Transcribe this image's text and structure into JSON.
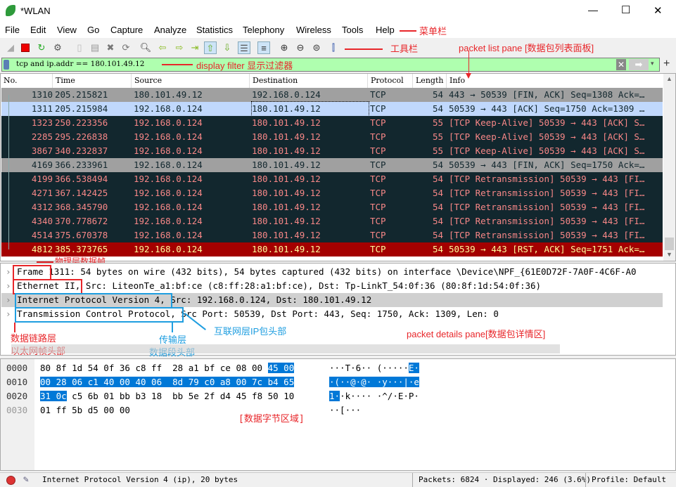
{
  "window": {
    "title": "*WLAN",
    "minimize": "—",
    "maximize": "☐",
    "close": "✕"
  },
  "menu": [
    "File",
    "Edit",
    "View",
    "Go",
    "Capture",
    "Analyze",
    "Statistics",
    "Telephony",
    "Wireless",
    "Tools",
    "Help"
  ],
  "toolbar_icons": [
    "shark-fin-start-icon",
    "stop-capture-icon",
    "restart-capture-icon",
    "capture-options-icon",
    "open-file-icon",
    "save-file-icon",
    "close-file-icon",
    "reload-file-icon",
    "find-packet-icon",
    "go-back-icon",
    "go-forward-icon",
    "go-to-packet-icon",
    "first-packet-icon",
    "last-packet-icon",
    "autoscroll-icon",
    "colorize-icon",
    "zoom-in-icon",
    "zoom-out-icon",
    "zoom-normal-icon",
    "resize-columns-icon"
  ],
  "filter": {
    "value": "tcp and ip.addr == 180.101.49.12"
  },
  "columns": [
    "No.",
    "Time",
    "Source",
    "Destination",
    "Protocol",
    "Length",
    "Info"
  ],
  "packets": [
    {
      "no": "1310",
      "time": "205.215821",
      "src": "180.101.49.12",
      "dst": "192.168.0.124",
      "proto": "TCP",
      "len": "54",
      "info": "443 → 50539 [FIN, ACK] Seq=1308 Ack=…",
      "style": "gray"
    },
    {
      "no": "1311",
      "time": "205.215984",
      "src": "192.168.0.124",
      "dst": "180.101.49.12",
      "proto": "TCP",
      "len": "54",
      "info": "50539 → 443 [ACK] Seq=1750 Ack=1309 …",
      "style": "selected"
    },
    {
      "no": "1323",
      "time": "250.223356",
      "src": "192.168.0.124",
      "dst": "180.101.49.12",
      "proto": "TCP",
      "len": "55",
      "info": "[TCP Keep-Alive] 50539 → 443 [ACK] S…",
      "style": "dark"
    },
    {
      "no": "2285",
      "time": "295.226838",
      "src": "192.168.0.124",
      "dst": "180.101.49.12",
      "proto": "TCP",
      "len": "55",
      "info": "[TCP Keep-Alive] 50539 → 443 [ACK] S…",
      "style": "dark"
    },
    {
      "no": "3867",
      "time": "340.232837",
      "src": "192.168.0.124",
      "dst": "180.101.49.12",
      "proto": "TCP",
      "len": "55",
      "info": "[TCP Keep-Alive] 50539 → 443 [ACK] S…",
      "style": "dark"
    },
    {
      "no": "4169",
      "time": "366.233961",
      "src": "192.168.0.124",
      "dst": "180.101.49.12",
      "proto": "TCP",
      "len": "54",
      "info": "50539 → 443 [FIN, ACK] Seq=1750 Ack=…",
      "style": "gray"
    },
    {
      "no": "4199",
      "time": "366.538494",
      "src": "192.168.0.124",
      "dst": "180.101.49.12",
      "proto": "TCP",
      "len": "54",
      "info": "[TCP Retransmission] 50539 → 443 [FI…",
      "style": "dark"
    },
    {
      "no": "4271",
      "time": "367.142425",
      "src": "192.168.0.124",
      "dst": "180.101.49.12",
      "proto": "TCP",
      "len": "54",
      "info": "[TCP Retransmission] 50539 → 443 [FI…",
      "style": "dark"
    },
    {
      "no": "4312",
      "time": "368.345790",
      "src": "192.168.0.124",
      "dst": "180.101.49.12",
      "proto": "TCP",
      "len": "54",
      "info": "[TCP Retransmission] 50539 → 443 [FI…",
      "style": "dark"
    },
    {
      "no": "4340",
      "time": "370.778672",
      "src": "192.168.0.124",
      "dst": "180.101.49.12",
      "proto": "TCP",
      "len": "54",
      "info": "[TCP Retransmission] 50539 → 443 [FI…",
      "style": "dark"
    },
    {
      "no": "4514",
      "time": "375.670378",
      "src": "192.168.0.124",
      "dst": "180.101.49.12",
      "proto": "TCP",
      "len": "54",
      "info": "[TCP Retransmission] 50539 → 443 [FI…",
      "style": "dark"
    },
    {
      "no": "4812",
      "time": "385.373765",
      "src": "192.168.0.124",
      "dst": "180.101.49.12",
      "proto": "TCP",
      "len": "54",
      "info": "50539 → 443 [RST, ACK] Seq=1751 Ack=…",
      "style": "red"
    }
  ],
  "row_colors": {
    "gray": [
      "#a0a0a0",
      "#12272e"
    ],
    "selected": [
      "#c0d8fc",
      "#12272e"
    ],
    "dark": [
      "#12272e",
      "#f78787"
    ],
    "red": [
      "#a40000",
      "#fffc9c"
    ]
  },
  "details": [
    {
      "head": "Frame",
      "rest": " 1311: 54 bytes on wire (432 bits), 54 bytes captured (432 bits) on interface \\Device\\NPF_{61E0D72F-7A0F-4C6F-A0"
    },
    {
      "head": "Ethernet II",
      "rest": ", Src: LiteonTe_a1:bf:ce (c8:ff:28:a1:bf:ce), Dst: Tp-LinkT_54:0f:36 (80:8f:1d:54:0f:36)"
    },
    {
      "head": "Internet Protocol Version 4",
      "rest": ", Src: 192.168.0.124, Dst: 180.101.49.12"
    },
    {
      "head": "Transmission Control Protocol",
      "rest": ", Src Port: 50539, Dst Port: 443, Seq: 1750, Ack: 1309, Len: 0"
    }
  ],
  "bytes": [
    {
      "offset": "0000",
      "pre": "80 8f 1d 54 0f 36 c8 ff  28 a1 bf ce 08 00 ",
      "hl": "45 00",
      "post": "",
      "apre": "···T·6·· (·····",
      "ahl": "E·",
      "apost": ""
    },
    {
      "offset": "0010",
      "pre": "",
      "hl": "00 28 06 c1 40 00 40 06  8d 79 c0 a8 00 7c b4 65",
      "post": "",
      "apre": "",
      "ahl": "·(··@·@· ·y···|·e",
      "apost": ""
    },
    {
      "offset": "0020",
      "pre": "",
      "hl": "31 0c",
      "post": " c5 6b 01 bb b3 18  bb 5e 2f d4 45 f8 50 10",
      "apre": "",
      "ahl": "1·",
      "apost": "·k···· ·^/·E·P·"
    },
    {
      "offset": "0030",
      "pre": "01 ff 5b d5 00 00",
      "hl": "",
      "post": "",
      "apre": "··[···",
      "ahl": "",
      "apost": ""
    }
  ],
  "status": {
    "field": "Internet Protocol Version 4 (ip), 20 bytes",
    "packets": "Packets: 6824 · Displayed: 246 (3.6%)",
    "profile": "Profile: Default"
  },
  "annotations": {
    "menubar": "菜单栏",
    "toolbar": "工具栏",
    "packet_list": "packet list pane [数据包列表面板]",
    "filter": "display filter 显示过滤器",
    "frame": "物理层数据帧",
    "datalink_1": "数据链路层",
    "datalink_2": "以太网帧头部",
    "transport_1": "传输层",
    "transport_2": "数据段头部",
    "ip": "互联网层IP包头部",
    "details": "packet details pane[数据包详情区]",
    "bytes": "[数据字节区域]"
  }
}
